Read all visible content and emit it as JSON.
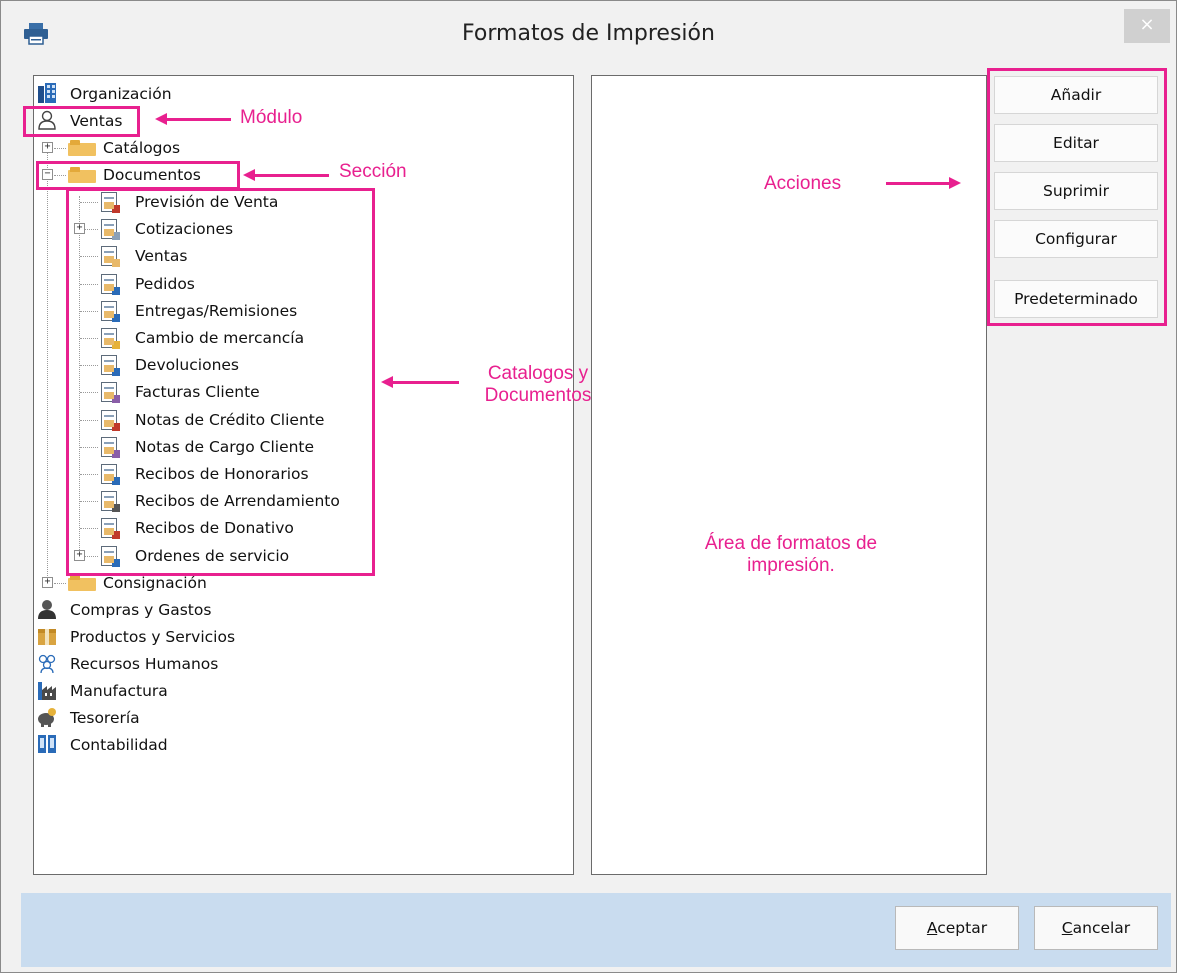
{
  "window": {
    "title": "Formatos de Impresión",
    "close_glyph": "×",
    "printer_icon": "printer-icon"
  },
  "tree": {
    "organizacion": "Organización",
    "ventas": "Ventas",
    "catalogos": "Catálogos",
    "documentos": "Documentos",
    "documentos_children": [
      "Previsión de Venta",
      "Cotizaciones",
      "Ventas",
      "Pedidos",
      "Entregas/Remisiones",
      "Cambio de mercancía",
      "Devoluciones",
      "Facturas Cliente",
      "Notas de Crédito Cliente",
      "Notas de Cargo Cliente",
      "Recibos de Honorarios",
      "Recibos de Arrendamiento",
      "Recibos de Donativo",
      "Ordenes de servicio"
    ],
    "consignacion": "Consignación",
    "modules": [
      "Compras y Gastos",
      "Productos y Servicios",
      "Recursos Humanos",
      "Manufactura",
      "Tesorería",
      "Contabilidad"
    ]
  },
  "actions": {
    "add": "Añadir",
    "edit": "Editar",
    "delete": "Suprimir",
    "configure": "Configurar",
    "default": "Predeterminado"
  },
  "footer": {
    "accept_first": "A",
    "accept_rest": "ceptar",
    "cancel_first": "C",
    "cancel_rest": "ancelar"
  },
  "annotations": {
    "modulo": "Módulo",
    "seccion": "Sección",
    "acciones": "Acciones",
    "catalogos_line1": "Catalogos y",
    "catalogos_line2": "Documentos",
    "area_line1": "Área de formatos de",
    "area_line2": "impresión."
  },
  "colors": {
    "annotation": "#e8208f",
    "footer_bg": "#c9dcef",
    "folder": "#f1c160"
  }
}
